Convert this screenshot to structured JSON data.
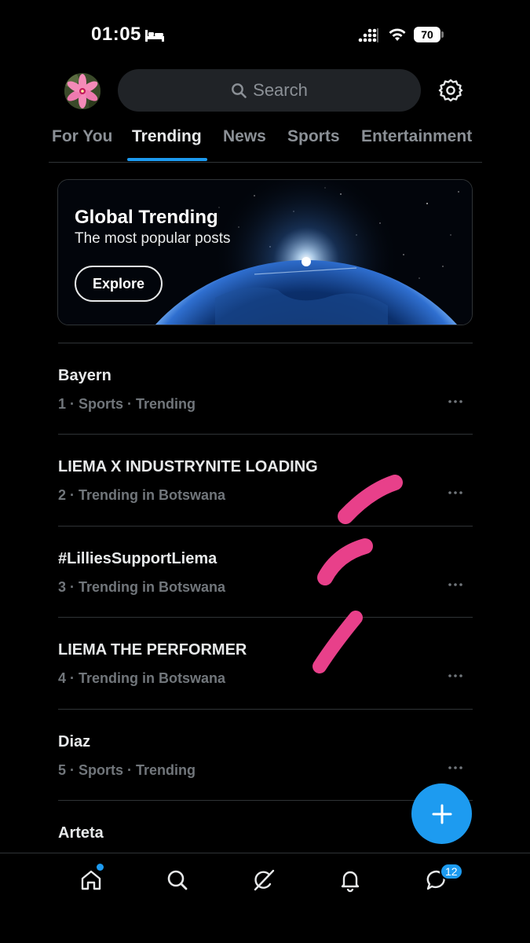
{
  "status_bar": {
    "time": "01:05",
    "battery": "70",
    "sleep_icon": "bed-icon",
    "signal_icon": "cellular-signal-icon",
    "wifi_icon": "wifi-icon"
  },
  "header": {
    "avatar_icon": "avatar",
    "search_placeholder": "Search",
    "settings_icon": "gear-icon"
  },
  "tabs": [
    {
      "label": "For You",
      "active": false
    },
    {
      "label": "Trending",
      "active": true
    },
    {
      "label": "News",
      "active": false
    },
    {
      "label": "Sports",
      "active": false
    },
    {
      "label": "Entertainment",
      "active": false
    }
  ],
  "banner": {
    "title": "Global Trending",
    "subtitle": "The most popular posts",
    "button_label": "Explore"
  },
  "trends": [
    {
      "title": "Bayern",
      "meta": "1 · Sports · Trending"
    },
    {
      "title": "LIEMA X INDUSTRYNITE LOADING",
      "meta": "2 · Trending in Botswana"
    },
    {
      "title": "#LilliesSupportLiema",
      "meta": "3 · Trending in Botswana"
    },
    {
      "title": "LIEMA THE PERFORMER",
      "meta": "4 · Trending in Botswana"
    },
    {
      "title": "Diaz",
      "meta": "5 · Sports · Trending"
    },
    {
      "title": "Arteta",
      "meta": ""
    }
  ],
  "fab": {
    "icon": "plus-icon"
  },
  "bottom_nav": {
    "items": [
      "home-icon",
      "search-icon",
      "grok-icon",
      "bell-icon",
      "messages-icon"
    ],
    "messages_badge": "12"
  },
  "colors": {
    "background": "#000000",
    "accent": "#1d9bf0",
    "scribble": "#e8408a",
    "secondary_text": "#71767b"
  }
}
